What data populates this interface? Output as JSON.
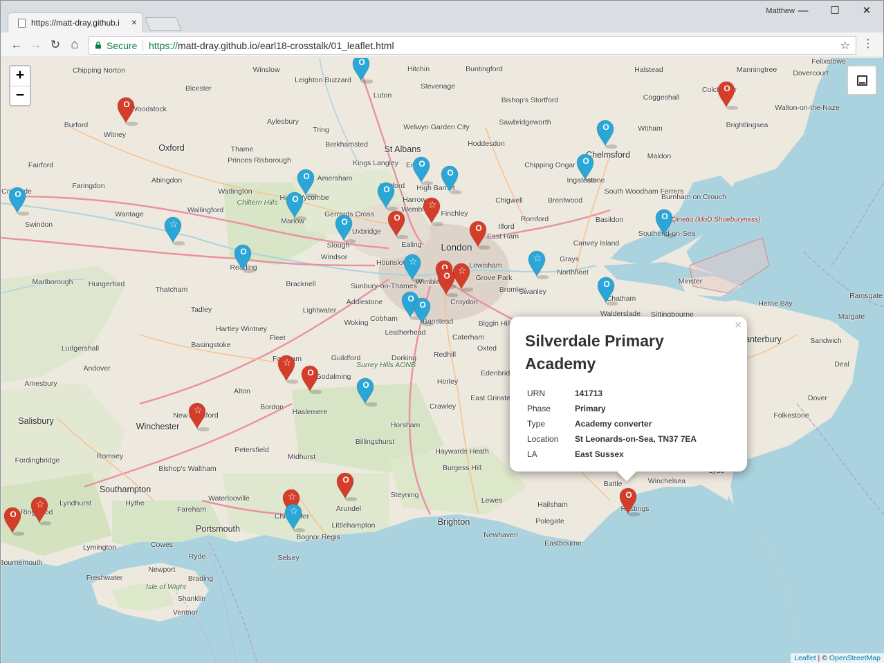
{
  "browser": {
    "tab_title": "https://matt-dray.github.i",
    "tab_close": "×",
    "user_name": "Matthew",
    "window_controls": {
      "minimize": "—",
      "maximize": "☐",
      "close": "✕"
    },
    "nav": {
      "back": "←",
      "forward": "→",
      "reload": "↻",
      "home": "⌂"
    },
    "secure_label": "Secure",
    "url_protocol": "https://",
    "url_rest": "matt-dray.github.io/earl18-crosstalk/01_leaflet.html",
    "star": "☆",
    "menu": "⋮"
  },
  "map": {
    "zoom_in": "+",
    "zoom_out": "−",
    "attribution": {
      "leaflet": "Leaflet",
      "separator": " | © ",
      "osm": "OpenStreetMap"
    },
    "colors": {
      "sea": "#aad3df",
      "land": "#eee9de",
      "red_marker": "#d33d29",
      "blue_marker": "#2aa6d8"
    },
    "places": [
      {
        "name": "Chipping Norton",
        "cls": ""
      },
      {
        "name": "Winslow",
        "cls": ""
      },
      {
        "name": "Hitchin",
        "cls": ""
      },
      {
        "name": "Buntingford",
        "cls": ""
      },
      {
        "name": "Halstead",
        "cls": ""
      },
      {
        "name": "Manningtree",
        "cls": ""
      },
      {
        "name": "Dovercourt",
        "cls": ""
      },
      {
        "name": "Felixstowe",
        "cls": ""
      },
      {
        "name": "Leighton Buzzard",
        "cls": ""
      },
      {
        "name": "Stevenage",
        "cls": ""
      },
      {
        "name": "Bishop's Stortford",
        "cls": ""
      },
      {
        "name": "Coggeshall",
        "cls": ""
      },
      {
        "name": "Bicester",
        "cls": ""
      },
      {
        "name": "Luton",
        "cls": ""
      },
      {
        "name": "Woodstock",
        "cls": ""
      },
      {
        "name": "Aylesbury",
        "cls": ""
      },
      {
        "name": "Welwyn Garden City",
        "cls": ""
      },
      {
        "name": "Sawbridgeworth",
        "cls": ""
      },
      {
        "name": "Witham",
        "cls": ""
      },
      {
        "name": "Brightlingsea",
        "cls": ""
      },
      {
        "name": "Walton-on-the-Naze",
        "cls": ""
      },
      {
        "name": "Burford",
        "cls": ""
      },
      {
        "name": "Witney",
        "cls": ""
      },
      {
        "name": "Oxford",
        "cls": "big"
      },
      {
        "name": "Thame",
        "cls": ""
      },
      {
        "name": "Tring",
        "cls": ""
      },
      {
        "name": "Berkhamsted",
        "cls": ""
      },
      {
        "name": "St Albans",
        "cls": "big"
      },
      {
        "name": "Hoddesdon",
        "cls": ""
      },
      {
        "name": "Chelmsford",
        "cls": "big"
      },
      {
        "name": "Maldon",
        "cls": ""
      },
      {
        "name": "Fairford",
        "cls": ""
      },
      {
        "name": "Princes Risborough",
        "cls": ""
      },
      {
        "name": "Kings Langley",
        "cls": ""
      },
      {
        "name": "Chipping Ongar",
        "cls": ""
      },
      {
        "name": "Ingatestone",
        "cls": ""
      },
      {
        "name": "Abingdon",
        "cls": ""
      },
      {
        "name": "Amersham",
        "cls": ""
      },
      {
        "name": "High Barnet",
        "cls": ""
      },
      {
        "name": "Faringdon",
        "cls": ""
      },
      {
        "name": "Watlington",
        "cls": ""
      },
      {
        "name": "Chiltern Hills",
        "cls": "italic"
      },
      {
        "name": "High Wycombe",
        "cls": ""
      },
      {
        "name": "Chigwell",
        "cls": ""
      },
      {
        "name": "Brentwood",
        "cls": ""
      },
      {
        "name": "South Woodham Ferrers",
        "cls": ""
      },
      {
        "name": "Burnham on Crouch",
        "cls": ""
      },
      {
        "name": "Swindon",
        "cls": ""
      },
      {
        "name": "Wallingford",
        "cls": ""
      },
      {
        "name": "Wantage",
        "cls": ""
      },
      {
        "name": "Marlow",
        "cls": ""
      },
      {
        "name": "Gerrards Cross",
        "cls": ""
      },
      {
        "name": "Uxbridge",
        "cls": ""
      },
      {
        "name": "Wembley",
        "cls": ""
      },
      {
        "name": "Finchley",
        "cls": ""
      },
      {
        "name": "Ilford",
        "cls": ""
      },
      {
        "name": "Romford",
        "cls": ""
      },
      {
        "name": "Basildon",
        "cls": ""
      },
      {
        "name": "Southend-on-Sea",
        "cls": ""
      },
      {
        "name": "Qinetiq (MoD Shoeburyness)",
        "cls": "range"
      },
      {
        "name": "Slough",
        "cls": ""
      },
      {
        "name": "Ealing",
        "cls": ""
      },
      {
        "name": "London",
        "cls": "huge"
      },
      {
        "name": "East Ham",
        "cls": ""
      },
      {
        "name": "Canvey Island",
        "cls": ""
      },
      {
        "name": "Reading",
        "cls": ""
      },
      {
        "name": "Windsor",
        "cls": ""
      },
      {
        "name": "Hounslow",
        "cls": ""
      },
      {
        "name": "Lewisham",
        "cls": ""
      },
      {
        "name": "Grays",
        "cls": ""
      },
      {
        "name": "Marlborough",
        "cls": ""
      },
      {
        "name": "Hungerford",
        "cls": ""
      },
      {
        "name": "Bracknell",
        "cls": ""
      },
      {
        "name": "Sunbury-on-Thames",
        "cls": ""
      },
      {
        "name": "Wimbledon",
        "cls": ""
      },
      {
        "name": "Grove Park",
        "cls": ""
      },
      {
        "name": "Northfleet",
        "cls": ""
      },
      {
        "name": "Thatcham",
        "cls": ""
      },
      {
        "name": "Bromley",
        "cls": ""
      },
      {
        "name": "Minster",
        "cls": ""
      },
      {
        "name": "Addlestone",
        "cls": ""
      },
      {
        "name": "Croydon",
        "cls": ""
      },
      {
        "name": "Swanley",
        "cls": ""
      },
      {
        "name": "Chatham",
        "cls": ""
      },
      {
        "name": "Herne Bay",
        "cls": ""
      },
      {
        "name": "Margate",
        "cls": ""
      },
      {
        "name": "Tadley",
        "cls": ""
      },
      {
        "name": "Lightwater",
        "cls": ""
      },
      {
        "name": "Cobham",
        "cls": ""
      },
      {
        "name": "Banstead",
        "cls": ""
      },
      {
        "name": "Walderslade",
        "cls": ""
      },
      {
        "name": "Sittingbourne",
        "cls": ""
      },
      {
        "name": "Ramsgate",
        "cls": ""
      },
      {
        "name": "Hartley Wintney",
        "cls": ""
      },
      {
        "name": "Woking",
        "cls": ""
      },
      {
        "name": "Biggin Hill",
        "cls": ""
      },
      {
        "name": "Leatherhead",
        "cls": ""
      },
      {
        "name": "Caterham",
        "cls": ""
      },
      {
        "name": "Canterbury",
        "cls": "big"
      },
      {
        "name": "Basingstoke",
        "cls": ""
      },
      {
        "name": "Fleet",
        "cls": ""
      },
      {
        "name": "Oxted",
        "cls": ""
      },
      {
        "name": "Sandwich",
        "cls": ""
      },
      {
        "name": "Ludgershall",
        "cls": ""
      },
      {
        "name": "Farnham",
        "cls": ""
      },
      {
        "name": "Guildford",
        "cls": ""
      },
      {
        "name": "Dorking",
        "cls": ""
      },
      {
        "name": "Redhill",
        "cls": ""
      },
      {
        "name": "Edenbridge",
        "cls": ""
      },
      {
        "name": "Deal",
        "cls": ""
      },
      {
        "name": "Andover",
        "cls": ""
      },
      {
        "name": "Surrey Hills AONB",
        "cls": "italic"
      },
      {
        "name": "Godalming",
        "cls": ""
      },
      {
        "name": "Horley",
        "cls": ""
      },
      {
        "name": "Amesbury",
        "cls": ""
      },
      {
        "name": "Alton",
        "cls": ""
      },
      {
        "name": "East Grinstead",
        "cls": ""
      },
      {
        "name": "Dover",
        "cls": ""
      },
      {
        "name": "Salisbury",
        "cls": "big"
      },
      {
        "name": "New Alresford",
        "cls": ""
      },
      {
        "name": "Bordon",
        "cls": ""
      },
      {
        "name": "Haslemere",
        "cls": ""
      },
      {
        "name": "Crawley",
        "cls": ""
      },
      {
        "name": "Folkestone",
        "cls": ""
      },
      {
        "name": "Winchester",
        "cls": "big"
      },
      {
        "name": "Horsham",
        "cls": ""
      },
      {
        "name": "Billingshurst",
        "cls": ""
      },
      {
        "name": "Petersfield",
        "cls": ""
      },
      {
        "name": "Haywards Heath",
        "cls": ""
      },
      {
        "name": "Romsey",
        "cls": ""
      },
      {
        "name": "Midhurst",
        "cls": ""
      },
      {
        "name": "Burgess Hill",
        "cls": ""
      },
      {
        "name": "Bishop's Waltham",
        "cls": ""
      },
      {
        "name": "Fordingbridge",
        "cls": ""
      },
      {
        "name": "Southampton",
        "cls": "big"
      },
      {
        "name": "Battle",
        "cls": ""
      },
      {
        "name": "Winchelsea",
        "cls": ""
      },
      {
        "name": "Lydd",
        "cls": ""
      },
      {
        "name": "Lyndhurst",
        "cls": ""
      },
      {
        "name": "Steyning",
        "cls": ""
      },
      {
        "name": "Ringwood",
        "cls": ""
      },
      {
        "name": "Hythe",
        "cls": ""
      },
      {
        "name": "Waterlooville",
        "cls": ""
      },
      {
        "name": "Lewes",
        "cls": ""
      },
      {
        "name": "Hailsham",
        "cls": ""
      },
      {
        "name": "Fareham",
        "cls": ""
      },
      {
        "name": "Chichester",
        "cls": ""
      },
      {
        "name": "Arundel",
        "cls": ""
      },
      {
        "name": "Hastings",
        "cls": ""
      },
      {
        "name": "Portsmouth",
        "cls": "big"
      },
      {
        "name": "Littlehampton",
        "cls": ""
      },
      {
        "name": "Brighton",
        "cls": "big"
      },
      {
        "name": "Polegate",
        "cls": ""
      },
      {
        "name": "Bognor Regis",
        "cls": ""
      },
      {
        "name": "Newhaven",
        "cls": ""
      },
      {
        "name": "Lymington",
        "cls": ""
      },
      {
        "name": "Cowes",
        "cls": ""
      },
      {
        "name": "Eastbourne",
        "cls": ""
      },
      {
        "name": "Ryde",
        "cls": ""
      },
      {
        "name": "Selsey",
        "cls": ""
      },
      {
        "name": "Bournemouth",
        "cls": ""
      },
      {
        "name": "Newport",
        "cls": ""
      },
      {
        "name": "Freshwater",
        "cls": ""
      },
      {
        "name": "Brading",
        "cls": ""
      },
      {
        "name": "Isle of Wight",
        "cls": "italic"
      },
      {
        "name": "Shanklin",
        "cls": ""
      },
      {
        "name": "Ventnor",
        "cls": ""
      },
      {
        "name": "Cricklade",
        "cls": ""
      },
      {
        "name": "Colchester",
        "cls": ""
      },
      {
        "name": "Enfield",
        "cls": ""
      },
      {
        "name": "Watford",
        "cls": ""
      },
      {
        "name": "Harrow",
        "cls": ""
      }
    ],
    "markers": [
      {
        "color": "red",
        "icon": "o"
      },
      {
        "color": "blue",
        "icon": "o"
      },
      {
        "color": "red",
        "icon": "o"
      },
      {
        "color": "blue",
        "icon": "o"
      },
      {
        "color": "blue",
        "icon": "o"
      },
      {
        "color": "blue",
        "icon": "o"
      },
      {
        "color": "blue",
        "icon": "o"
      },
      {
        "color": "blue",
        "icon": "o"
      },
      {
        "color": "blue",
        "icon": "o"
      },
      {
        "color": "blue",
        "icon": "o"
      },
      {
        "color": "blue",
        "icon": "o"
      },
      {
        "color": "blue",
        "icon": "star"
      },
      {
        "color": "red",
        "icon": "star"
      },
      {
        "color": "red",
        "icon": "o"
      },
      {
        "color": "blue",
        "icon": "o"
      },
      {
        "color": "blue",
        "icon": "o"
      },
      {
        "color": "blue",
        "icon": "o"
      },
      {
        "color": "red",
        "icon": "o"
      },
      {
        "color": "blue",
        "icon": "star"
      },
      {
        "color": "red",
        "icon": "o"
      },
      {
        "color": "red",
        "icon": "o"
      },
      {
        "color": "red",
        "icon": "star"
      },
      {
        "color": "blue",
        "icon": "star"
      },
      {
        "color": "blue",
        "icon": "o"
      },
      {
        "color": "blue",
        "icon": "o"
      },
      {
        "color": "blue",
        "icon": "o"
      },
      {
        "color": "red",
        "icon": "star"
      },
      {
        "color": "red",
        "icon": "o"
      },
      {
        "color": "blue",
        "icon": "o"
      },
      {
        "color": "red",
        "icon": "star"
      },
      {
        "color": "red",
        "icon": "o"
      },
      {
        "color": "red",
        "icon": "o"
      },
      {
        "color": "red",
        "icon": "star"
      },
      {
        "color": "red",
        "icon": "star"
      },
      {
        "color": "blue",
        "icon": "star"
      },
      {
        "color": "red",
        "icon": "o"
      }
    ],
    "popup": {
      "close": "×",
      "title": "Silverdale Primary Academy",
      "rows": [
        {
          "key": "URN",
          "value": "141713"
        },
        {
          "key": "Phase",
          "value": "Primary"
        },
        {
          "key": "Type",
          "value": "Academy converter"
        },
        {
          "key": "Location",
          "value": "St Leonards-on-Sea, TN37 7EA"
        },
        {
          "key": "LA",
          "value": "East Sussex"
        }
      ]
    }
  }
}
